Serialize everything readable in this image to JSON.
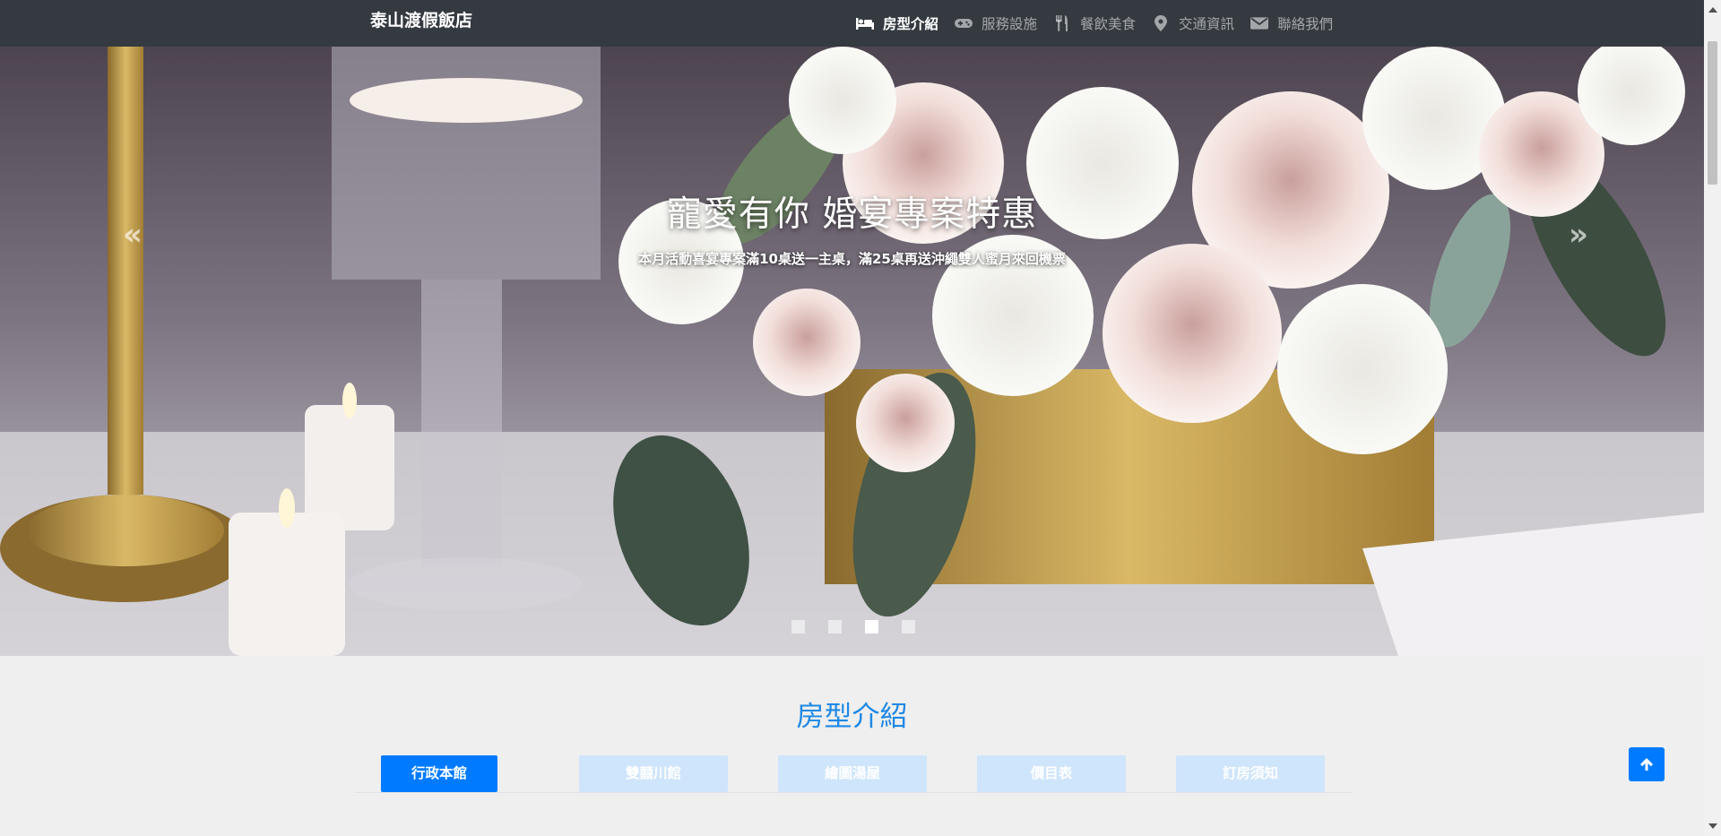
{
  "navbar": {
    "brand": "泰山渡假飯店",
    "items": [
      {
        "label": "房型介紹",
        "icon": "bed-icon",
        "active": true
      },
      {
        "label": "服務設施",
        "icon": "gamepad-icon",
        "active": false
      },
      {
        "label": "餐飲美食",
        "icon": "utensils-icon",
        "active": false
      },
      {
        "label": "交通資訊",
        "icon": "map-marker-icon",
        "active": false
      },
      {
        "label": "聯絡我們",
        "icon": "envelope-icon",
        "active": false
      }
    ]
  },
  "carousel": {
    "title": "寵愛有你 婚宴專案特惠",
    "subtitle": "本月活動喜宴專案滿10桌送一主桌，滿25桌再送沖繩雙人蜜月來回機票",
    "prev_label": "«",
    "next_label": "»",
    "slide_count": 4,
    "active_slide": 3
  },
  "section": {
    "title": "房型介紹",
    "tabs": [
      "行政本館",
      "雙囍川館",
      "繪圖湯屋",
      "價目表",
      "訂房須知"
    ],
    "active_tab": 0
  },
  "colors": {
    "navbar": "#343a40",
    "accent": "#007bff",
    "tab_inactive": "#cfe5fb",
    "title_blue": "#1e88e5"
  },
  "back_to_top": {
    "icon": "arrow-up-icon"
  }
}
